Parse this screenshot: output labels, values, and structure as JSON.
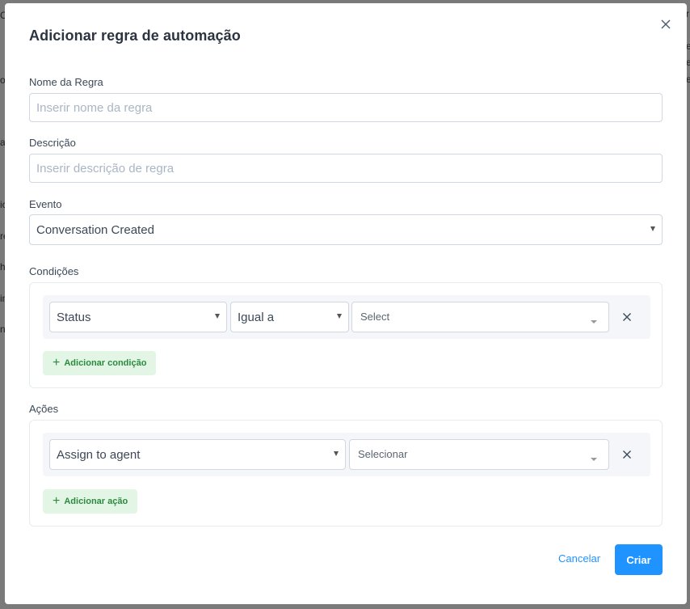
{
  "background": {
    "fragments": [
      "C",
      "or",
      "a",
      "ic",
      "re",
      "h",
      "in",
      "n",
      "r",
      "e",
      "e",
      "e"
    ]
  },
  "modal": {
    "title": "Adicionar regra de automação",
    "close_icon": "close-icon",
    "rule_name": {
      "label": "Nome da Regra",
      "value": "",
      "placeholder": "Inserir nome da regra"
    },
    "description": {
      "label": "Descrição",
      "value": "",
      "placeholder": "Inserir descrição de regra"
    },
    "event": {
      "label": "Evento",
      "selected": "Conversation Created"
    },
    "conditions": {
      "label": "Condições",
      "rows": [
        {
          "attribute": "Status",
          "operator": "Igual a",
          "value_placeholder": "Select"
        }
      ],
      "add_label": "Adicionar condição"
    },
    "actions": {
      "label": "Ações",
      "rows": [
        {
          "action": "Assign to agent",
          "value_placeholder": "Selecionar"
        }
      ],
      "add_label": "Adicionar ação"
    },
    "footer": {
      "cancel_label": "Cancelar",
      "create_label": "Criar"
    }
  },
  "colors": {
    "primary": "#1f93ff",
    "success_bg": "#e3f6e6",
    "success_text": "#2b8a3e"
  }
}
